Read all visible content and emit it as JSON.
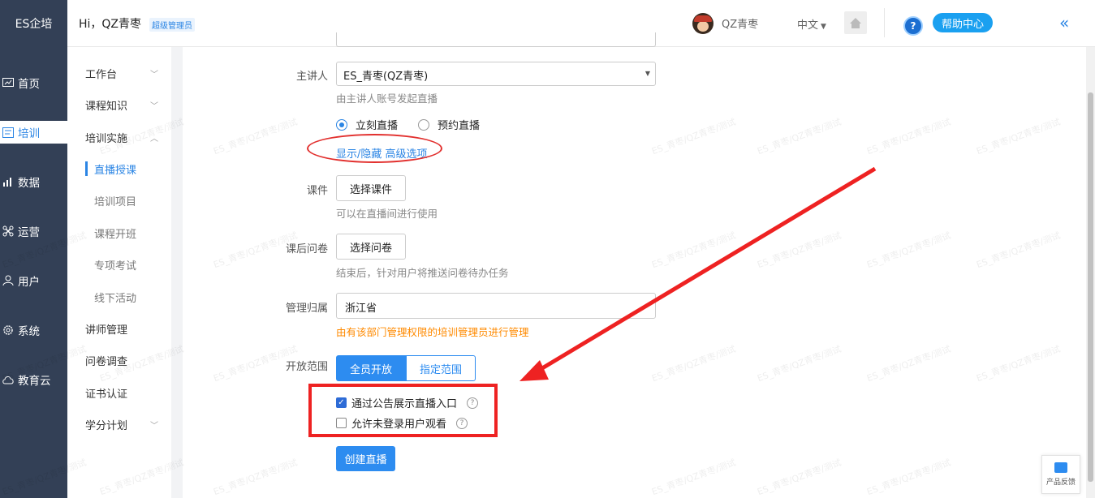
{
  "rail": {
    "logo": "ES企培",
    "items": [
      {
        "label": "首页",
        "icon": "chart-icon"
      },
      {
        "label": "培训",
        "icon": "training-icon",
        "active": true
      },
      {
        "label": "数据",
        "icon": "data-icon"
      },
      {
        "label": "运营",
        "icon": "operation-icon"
      },
      {
        "label": "用户",
        "icon": "user-icon"
      },
      {
        "label": "系统",
        "icon": "gear-icon"
      },
      {
        "label": "教育云",
        "icon": "cloud-icon"
      }
    ]
  },
  "header": {
    "greeting": "Hi，QZ青枣",
    "role_badge": "超级管理员",
    "username": "QZ青枣",
    "language": "中文",
    "help": "帮助中心",
    "help_q": "?"
  },
  "subnav": {
    "items": [
      {
        "label": "工作台",
        "chevron": "down"
      },
      {
        "label": "课程知识",
        "chevron": "down"
      },
      {
        "label": "培训实施",
        "chevron": "up"
      },
      {
        "label": "直播授课",
        "child": true,
        "active": true
      },
      {
        "label": "培训项目",
        "child": true
      },
      {
        "label": "课程开班",
        "child": true
      },
      {
        "label": "专项考试",
        "child": true
      },
      {
        "label": "线下活动",
        "child": true
      },
      {
        "label": "讲师管理"
      },
      {
        "label": "问卷调查"
      },
      {
        "label": "证书认证"
      },
      {
        "label": "学分计划",
        "chevron": "down"
      }
    ]
  },
  "form": {
    "presenter_label": "主讲人",
    "presenter_value": "ES_青枣(QZ青枣)",
    "presenter_hint": "由主讲人账号发起直播",
    "radio_now": "立刻直播",
    "radio_scheduled": "预约直播",
    "advanced_link": "显示/隐藏 高级选项",
    "courseware_label": "课件",
    "courseware_button": "选择课件",
    "courseware_hint": "可以在直播间进行使用",
    "survey_label": "课后问卷",
    "survey_button": "选择问卷",
    "survey_hint": "结束后，针对用户将推送问卷待办任务",
    "ownership_label": "管理归属",
    "ownership_value": "浙江省",
    "ownership_hint": "由有该部门管理权限的培训管理员进行管理",
    "scope_label": "开放范围",
    "scope_all": "全员开放",
    "scope_specific": "指定范围",
    "check_notice": "通过公告展示直播入口",
    "check_guest": "允许未登录用户观看",
    "submit": "创建直播"
  },
  "feedback": "产品反馈",
  "watermark": "ES_青枣/QZ青枣/测试",
  "colors": {
    "primary": "#2d8cf0",
    "rail_bg": "#334056",
    "annotation": "#ee2222",
    "warning": "#ff8a00"
  }
}
